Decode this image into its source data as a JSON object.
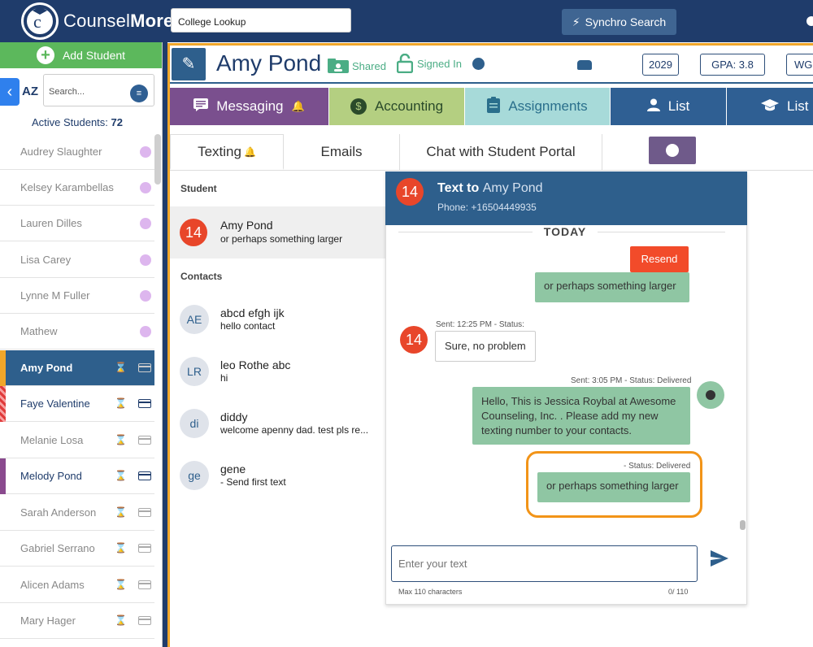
{
  "app": {
    "brand_light": "Counsel",
    "brand_bold": "More"
  },
  "topbar": {
    "college_lookup": "College Lookup",
    "synchro_search": "Synchro Search"
  },
  "sidebar": {
    "add_student": "Add Student",
    "sort_label": "AZ",
    "search_placeholder": "Search...",
    "active_label": "Active Students:",
    "active_count": "72",
    "students": [
      {
        "name": "Audrey Slaughter"
      },
      {
        "name": "Kelsey Karambellas"
      },
      {
        "name": "Lauren Dilles"
      },
      {
        "name": "Lisa Carey"
      },
      {
        "name": "Lynne M Fuller"
      },
      {
        "name": "Mathew"
      },
      {
        "name": "Amy Pond"
      },
      {
        "name": "Faye Valentine"
      },
      {
        "name": "Melanie Losa"
      },
      {
        "name": "Melody Pond"
      },
      {
        "name": "Sarah Anderson"
      },
      {
        "name": "Gabriel Serrano"
      },
      {
        "name": "Alicen Adams"
      },
      {
        "name": "Mary Hager"
      }
    ]
  },
  "header": {
    "student_name": "Amy Pond",
    "shared": "Shared",
    "signed_in": "Signed In",
    "year": "2029",
    "gpa": "GPA: 3.8",
    "wgpa": "WGP"
  },
  "tabs": {
    "messaging": "Messaging",
    "accounting": "Accounting",
    "assignments": "Assignments",
    "list1": "List",
    "list2": "List"
  },
  "subtabs": {
    "texting": "Texting",
    "emails": "Emails",
    "chat": "Chat with Student Portal"
  },
  "contacts": {
    "student_heading": "Student",
    "student_badge": "14",
    "student_name": "Amy Pond",
    "student_msg": "or perhaps something larger",
    "contacts_heading": "Contacts",
    "list": [
      {
        "initials": "AE",
        "name": "abcd efgh ijk",
        "msg": "hello contact"
      },
      {
        "initials": "LR",
        "name": "leo Rothe abc",
        "msg": "hi"
      },
      {
        "initials": "di",
        "name": "diddy",
        "msg": "welcome apenny dad. test pls re..."
      },
      {
        "initials": "ge",
        "name": "gene",
        "msg": "- Send first text"
      }
    ]
  },
  "chat": {
    "badge": "14",
    "title_prefix": "Text to",
    "title_name": "Amy Pond",
    "phone": "Phone: +16504449935",
    "today": "TODAY",
    "resend": "Resend",
    "msg1": "or perhaps something larger",
    "meta2": "Sent: 12:25 PM - Status:",
    "msg2": "Sure, no problem",
    "meta3": "Sent: 3:05 PM - Status: Delivered",
    "msg3": "Hello, This is Jessica Roybal at Awesome Counseling, Inc. . Please add my new texting number to your contacts.",
    "meta4": "- Status: Delivered",
    "msg4": "or perhaps something larger",
    "input_placeholder": "Enter your text",
    "max_chars": "Max 110 characters",
    "char_count": "0/ 110"
  },
  "colors": {
    "navy": "#1f3c6b",
    "accent_orange": "#f29418",
    "bubble_green": "#8fc6a3",
    "alert_red": "#e8462a"
  }
}
